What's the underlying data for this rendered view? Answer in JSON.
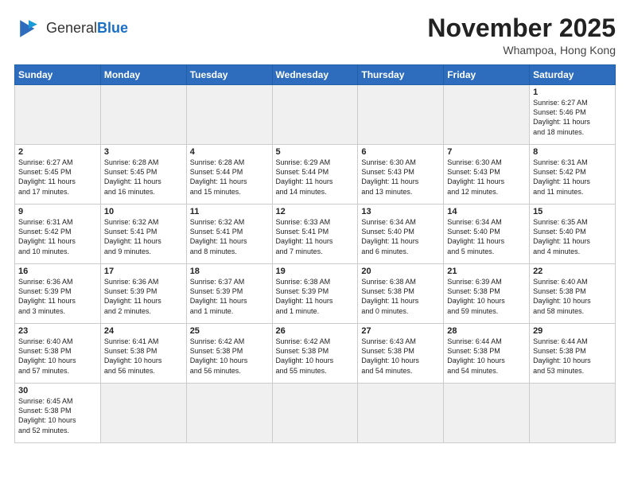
{
  "header": {
    "logo_general": "General",
    "logo_blue": "Blue",
    "month_year": "November 2025",
    "location": "Whampoa, Hong Kong"
  },
  "weekdays": [
    "Sunday",
    "Monday",
    "Tuesday",
    "Wednesday",
    "Thursday",
    "Friday",
    "Saturday"
  ],
  "weeks": [
    [
      {
        "day": "",
        "info": "",
        "empty": true
      },
      {
        "day": "",
        "info": "",
        "empty": true
      },
      {
        "day": "",
        "info": "",
        "empty": true
      },
      {
        "day": "",
        "info": "",
        "empty": true
      },
      {
        "day": "",
        "info": "",
        "empty": true
      },
      {
        "day": "",
        "info": "",
        "empty": true
      },
      {
        "day": "1",
        "info": "Sunrise: 6:27 AM\nSunset: 5:46 PM\nDaylight: 11 hours\nand 18 minutes."
      }
    ],
    [
      {
        "day": "2",
        "info": "Sunrise: 6:27 AM\nSunset: 5:45 PM\nDaylight: 11 hours\nand 17 minutes."
      },
      {
        "day": "3",
        "info": "Sunrise: 6:28 AM\nSunset: 5:45 PM\nDaylight: 11 hours\nand 16 minutes."
      },
      {
        "day": "4",
        "info": "Sunrise: 6:28 AM\nSunset: 5:44 PM\nDaylight: 11 hours\nand 15 minutes."
      },
      {
        "day": "5",
        "info": "Sunrise: 6:29 AM\nSunset: 5:44 PM\nDaylight: 11 hours\nand 14 minutes."
      },
      {
        "day": "6",
        "info": "Sunrise: 6:30 AM\nSunset: 5:43 PM\nDaylight: 11 hours\nand 13 minutes."
      },
      {
        "day": "7",
        "info": "Sunrise: 6:30 AM\nSunset: 5:43 PM\nDaylight: 11 hours\nand 12 minutes."
      },
      {
        "day": "8",
        "info": "Sunrise: 6:31 AM\nSunset: 5:42 PM\nDaylight: 11 hours\nand 11 minutes."
      }
    ],
    [
      {
        "day": "9",
        "info": "Sunrise: 6:31 AM\nSunset: 5:42 PM\nDaylight: 11 hours\nand 10 minutes."
      },
      {
        "day": "10",
        "info": "Sunrise: 6:32 AM\nSunset: 5:41 PM\nDaylight: 11 hours\nand 9 minutes."
      },
      {
        "day": "11",
        "info": "Sunrise: 6:32 AM\nSunset: 5:41 PM\nDaylight: 11 hours\nand 8 minutes."
      },
      {
        "day": "12",
        "info": "Sunrise: 6:33 AM\nSunset: 5:41 PM\nDaylight: 11 hours\nand 7 minutes."
      },
      {
        "day": "13",
        "info": "Sunrise: 6:34 AM\nSunset: 5:40 PM\nDaylight: 11 hours\nand 6 minutes."
      },
      {
        "day": "14",
        "info": "Sunrise: 6:34 AM\nSunset: 5:40 PM\nDaylight: 11 hours\nand 5 minutes."
      },
      {
        "day": "15",
        "info": "Sunrise: 6:35 AM\nSunset: 5:40 PM\nDaylight: 11 hours\nand 4 minutes."
      }
    ],
    [
      {
        "day": "16",
        "info": "Sunrise: 6:36 AM\nSunset: 5:39 PM\nDaylight: 11 hours\nand 3 minutes."
      },
      {
        "day": "17",
        "info": "Sunrise: 6:36 AM\nSunset: 5:39 PM\nDaylight: 11 hours\nand 2 minutes."
      },
      {
        "day": "18",
        "info": "Sunrise: 6:37 AM\nSunset: 5:39 PM\nDaylight: 11 hours\nand 1 minute."
      },
      {
        "day": "19",
        "info": "Sunrise: 6:38 AM\nSunset: 5:39 PM\nDaylight: 11 hours\nand 1 minute."
      },
      {
        "day": "20",
        "info": "Sunrise: 6:38 AM\nSunset: 5:38 PM\nDaylight: 11 hours\nand 0 minutes."
      },
      {
        "day": "21",
        "info": "Sunrise: 6:39 AM\nSunset: 5:38 PM\nDaylight: 10 hours\nand 59 minutes."
      },
      {
        "day": "22",
        "info": "Sunrise: 6:40 AM\nSunset: 5:38 PM\nDaylight: 10 hours\nand 58 minutes."
      }
    ],
    [
      {
        "day": "23",
        "info": "Sunrise: 6:40 AM\nSunset: 5:38 PM\nDaylight: 10 hours\nand 57 minutes."
      },
      {
        "day": "24",
        "info": "Sunrise: 6:41 AM\nSunset: 5:38 PM\nDaylight: 10 hours\nand 56 minutes."
      },
      {
        "day": "25",
        "info": "Sunrise: 6:42 AM\nSunset: 5:38 PM\nDaylight: 10 hours\nand 56 minutes."
      },
      {
        "day": "26",
        "info": "Sunrise: 6:42 AM\nSunset: 5:38 PM\nDaylight: 10 hours\nand 55 minutes."
      },
      {
        "day": "27",
        "info": "Sunrise: 6:43 AM\nSunset: 5:38 PM\nDaylight: 10 hours\nand 54 minutes."
      },
      {
        "day": "28",
        "info": "Sunrise: 6:44 AM\nSunset: 5:38 PM\nDaylight: 10 hours\nand 54 minutes."
      },
      {
        "day": "29",
        "info": "Sunrise: 6:44 AM\nSunset: 5:38 PM\nDaylight: 10 hours\nand 53 minutes."
      }
    ],
    [
      {
        "day": "30",
        "info": "Sunrise: 6:45 AM\nSunset: 5:38 PM\nDaylight: 10 hours\nand 52 minutes."
      },
      {
        "day": "",
        "info": "",
        "empty": true
      },
      {
        "day": "",
        "info": "",
        "empty": true
      },
      {
        "day": "",
        "info": "",
        "empty": true
      },
      {
        "day": "",
        "info": "",
        "empty": true
      },
      {
        "day": "",
        "info": "",
        "empty": true
      },
      {
        "day": "",
        "info": "",
        "empty": true
      }
    ]
  ]
}
